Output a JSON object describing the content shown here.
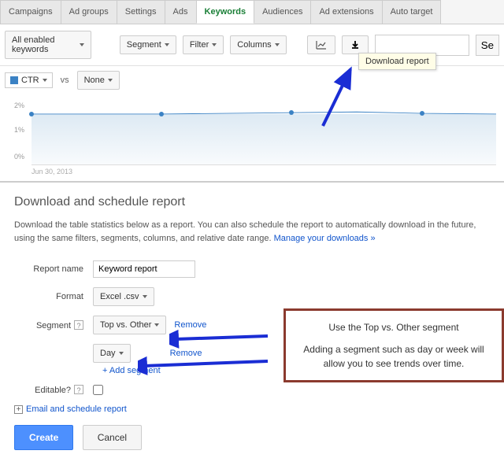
{
  "tabs": [
    {
      "label": "Campaigns"
    },
    {
      "label": "Ad groups"
    },
    {
      "label": "Settings"
    },
    {
      "label": "Ads"
    },
    {
      "label": "Keywords",
      "active": true
    },
    {
      "label": "Audiences"
    },
    {
      "label": "Ad extensions"
    },
    {
      "label": "Auto target"
    }
  ],
  "toolbar": {
    "keywords_filter": "All enabled keywords",
    "segment": "Segment",
    "filter": "Filter",
    "columns": "Columns",
    "search_placeholder": "",
    "search_btn": "Se",
    "download_tooltip": "Download report"
  },
  "metrics": {
    "ctr_label": "CTR",
    "vs": "vs",
    "none": "None"
  },
  "chart_data": {
    "type": "line",
    "title": "",
    "xlabel": "",
    "ylabel": "",
    "ylim": [
      0,
      2
    ],
    "y_ticks": [
      "2%",
      "1%",
      "0%"
    ],
    "x_start_label": "Jun 30, 2013",
    "series": [
      {
        "name": "CTR",
        "values": [
          1.55,
          1.55,
          1.55,
          1.58,
          1.6,
          1.62,
          1.58,
          1.55
        ]
      }
    ]
  },
  "report": {
    "title": "Download and schedule report",
    "description_1": "Download the table statistics below as a report. You can also schedule the report to automatically download in the future, using the same filters, segments, columns, and relative date range. ",
    "manage_link": "Manage your downloads »",
    "name_label": "Report name",
    "name_value": "Keyword report",
    "format_label": "Format",
    "format_value": "Excel .csv",
    "segment_label": "Segment",
    "segment1_value": "Top vs. Other",
    "segment2_value": "Day",
    "remove": "Remove",
    "add_segment": "+ Add segment",
    "editable_label": "Editable?",
    "email_label": "Email and schedule report",
    "create_btn": "Create",
    "cancel_btn": "Cancel"
  },
  "callout": {
    "line1": "Use the Top vs. Other segment",
    "line2": "Adding a segment such as day or week will allow you to see trends over time."
  }
}
